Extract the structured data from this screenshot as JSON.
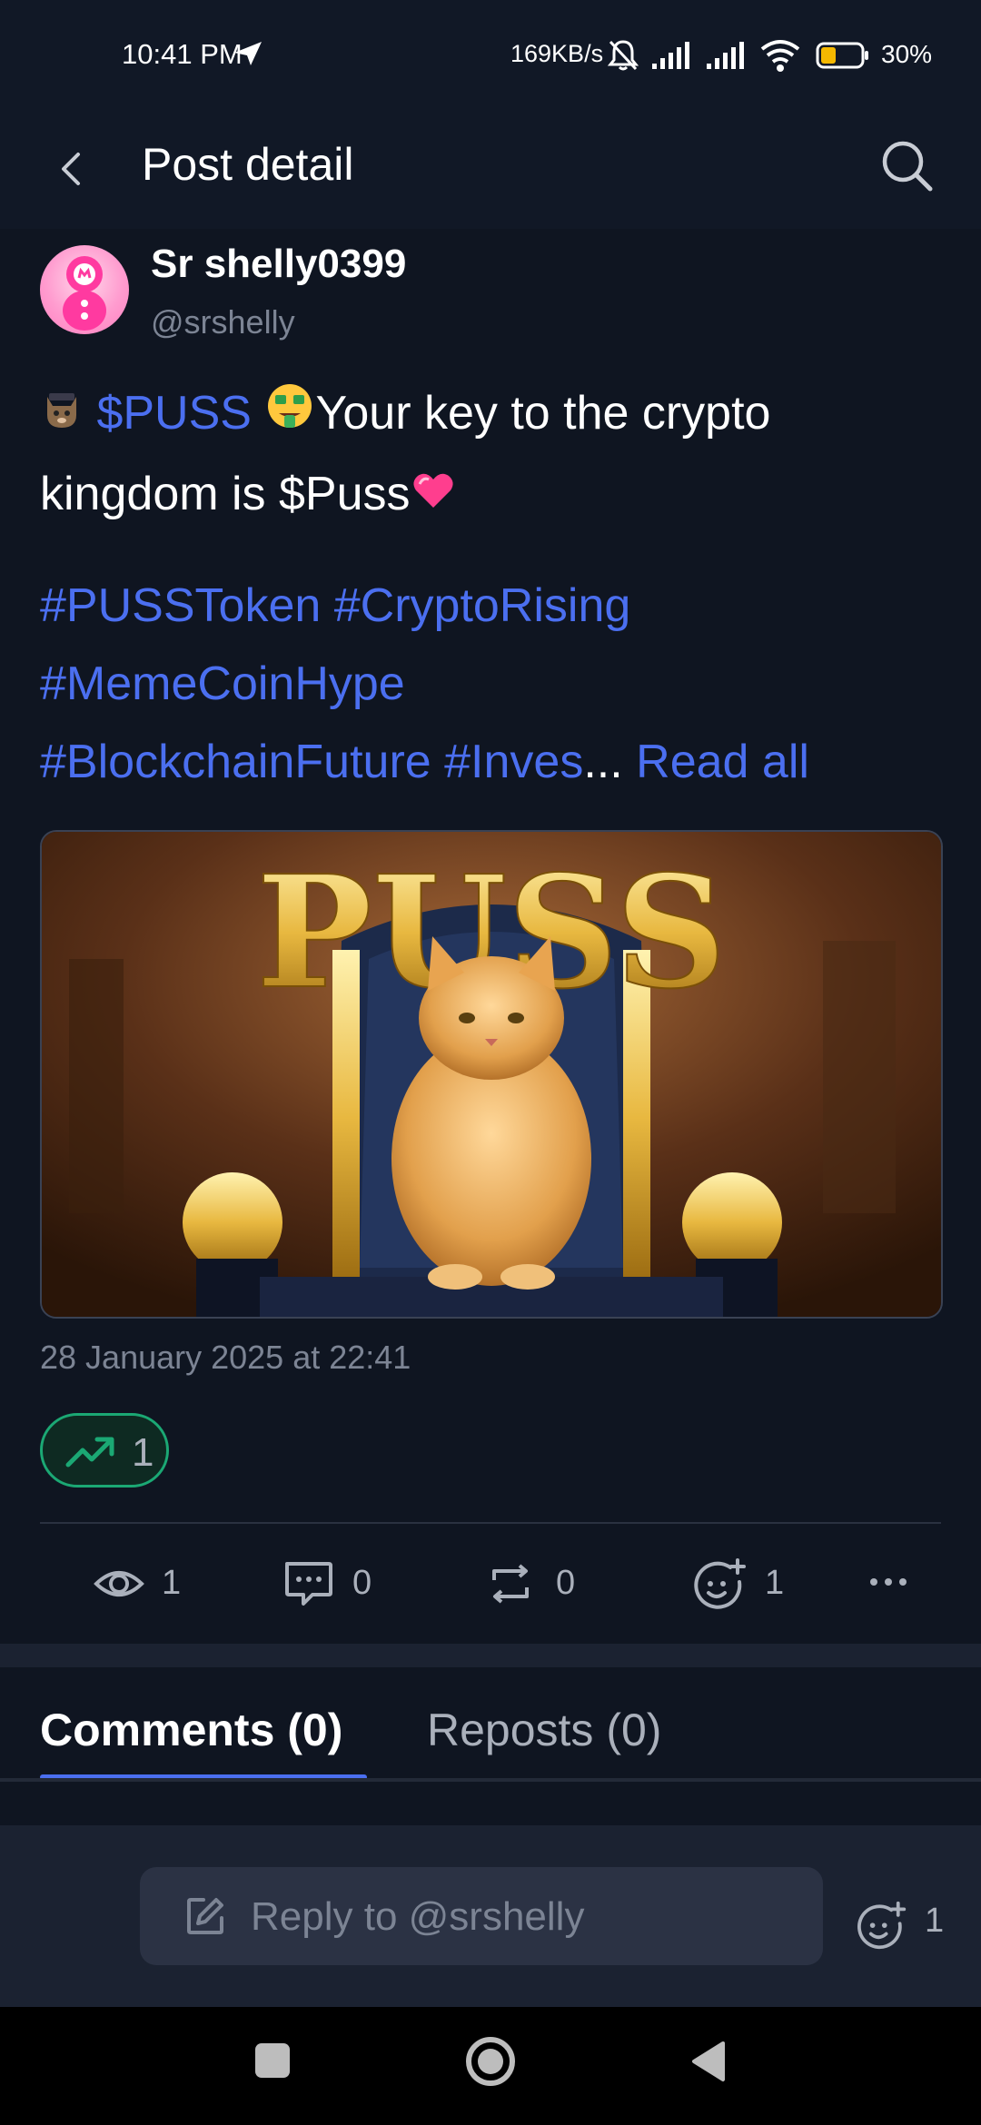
{
  "status_bar": {
    "time": "10:41 PM",
    "network_speed": "169KB/s",
    "battery": "30%"
  },
  "header": {
    "title": "Post detail"
  },
  "post": {
    "author_name": "Sr shelly0399",
    "author_handle": "@srshelly",
    "ticker": "$PUSS",
    "text_part1": "Your key to the crypto",
    "text_part2": "kingdom is $Puss",
    "hashtags_line1": "#PUSSToken #CryptoRising",
    "hashtags_line2": "#MemeCoinHype",
    "hashtags_line3": "#BlockchainFuture #Inves",
    "ellipsis": "...",
    "read_all": "Read all",
    "image_title": "PUSS",
    "timestamp": "28 January 2025 at 22:41",
    "trend_count": "1"
  },
  "stats": {
    "views": "1",
    "comments": "0",
    "reposts": "0",
    "reactions": "1"
  },
  "tabs": {
    "comments": "Comments (0)",
    "reposts": "Reposts (0)"
  },
  "reply": {
    "placeholder": "Reply to @srshelly",
    "reaction_count": "1"
  },
  "colors": {
    "background": "#0f1521",
    "accent": "#4b6ff0",
    "trend": "#1ba874",
    "muted": "#7c8494"
  }
}
